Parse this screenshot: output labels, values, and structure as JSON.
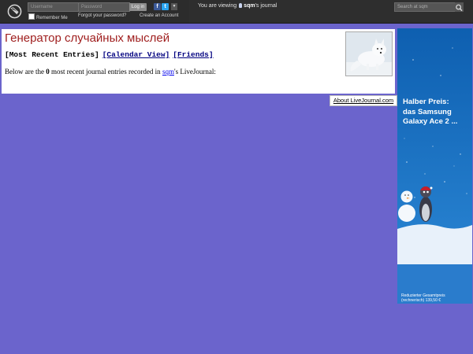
{
  "topbar": {
    "username_placeholder": "Username",
    "password_placeholder": "Password",
    "login_label": "Log in",
    "facebook_glyph": "f",
    "twitter_glyph": "t",
    "more_glyph": "▼",
    "remember_label": "Remember Me",
    "forgot_label": "Forgot your password?",
    "create_label": "Create an Account",
    "viewing_prefix": "You are viewing",
    "viewing_user": "sqm",
    "viewing_suffix": "'s journal",
    "search_placeholder": "Search at sqm",
    "icons": [
      "livejournal-logo-icon",
      "facebook-icon",
      "twitter-icon",
      "user-icon",
      "search-icon"
    ]
  },
  "journal": {
    "title": "Генератор случайных мыслей",
    "nav_current": "[Most Recent Entries]",
    "nav_calendar": "[Calendar View]",
    "nav_friends": "[Friends]",
    "desc_prefix": "Below are the",
    "desc_count": "0",
    "desc_middle": "most recent journal entries recorded in",
    "desc_user": "sqm",
    "desc_suffix": "'s LiveJournal:"
  },
  "about_link": "About LiveJournal.com",
  "ad": {
    "headline_1": "Halber Preis:",
    "headline_2": "das Samsung",
    "headline_3": "Galaxy Ace 2 ...",
    "fine_1": "Reduzierter Gesamtpreis",
    "fine_2": "(rechnerisch) 139,50 €"
  },
  "colors": {
    "page_background": "#6b64cc",
    "title": "#a02020",
    "ad_background": "#1f78c8"
  }
}
